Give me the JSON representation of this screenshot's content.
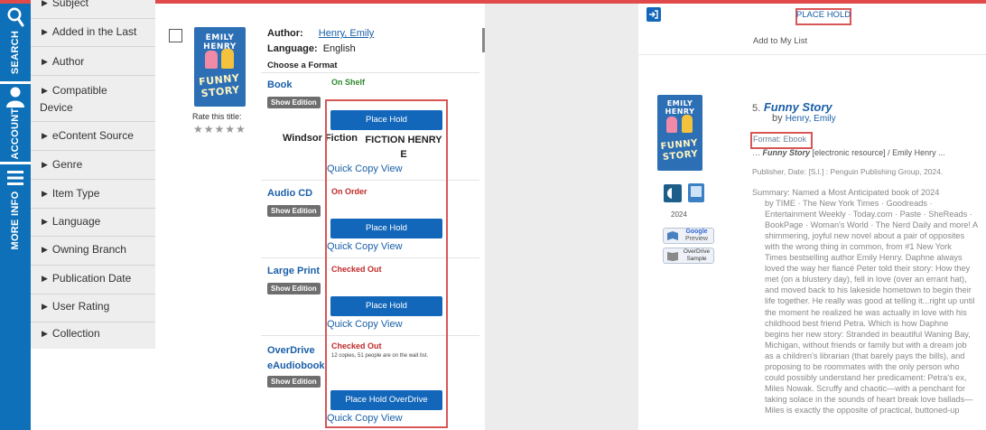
{
  "sidebar_tabs": [
    {
      "label": "SEARCH",
      "icon": "search-icon"
    },
    {
      "label": "ACCOUNT",
      "icon": "user-icon"
    },
    {
      "label": "MORE INFO",
      "icon": "menu-icon"
    }
  ],
  "facets": [
    "Subject",
    "Added in the Last",
    "Author",
    "Compatible Device",
    "eContent Source",
    "Genre",
    "Item Type",
    "Language",
    "Owning Branch",
    "Publication Date",
    "User Rating",
    "Collection"
  ],
  "result": {
    "cover": {
      "author_text": "EMILY HENRY",
      "title_text": "FUNNY STORY"
    },
    "rate_label": "Rate this title:",
    "stars": "★★★★★",
    "author_label": "Author:",
    "author_value": "Henry, Emily",
    "language_label": "Language:",
    "language_value": "English",
    "choose_format": "Choose a Format",
    "show_edition": "Show Edition",
    "formats": [
      {
        "name": "Book",
        "status": "On Shelf",
        "button": "Place Hold",
        "location": "Windsor Fiction",
        "call_number": "FICTION HENRY E",
        "quick_copy": "Quick Copy View"
      },
      {
        "name": "Audio CD",
        "status": "On Order",
        "button": "Place Hold",
        "quick_copy": "Quick Copy View"
      },
      {
        "name": "Large Print",
        "status": "Checked Out",
        "button": "Place Hold",
        "quick_copy": "Quick Copy View"
      },
      {
        "name": "OverDrive eAudiobook",
        "status": "Checked Out",
        "note": "12 copies, 51 people are on the wait list.",
        "button": "Place Hold OverDrive",
        "quick_copy": "Quick Copy View"
      }
    ]
  },
  "detail": {
    "place_hold": "PLACE HOLD",
    "add_to_list": "Add to My List",
    "number": "5.",
    "title": "Funny Story",
    "by_label": "by",
    "author": "Henry, Emily",
    "format_line": "Format: Ebook",
    "statement_title": "Funny Story",
    "statement_rest": "[electronic resource] / Emily Henry ...",
    "publisher": "Publisher, Date: [S.l.] : Penguin Publishing Group, 2024.",
    "year": "2024",
    "google_preview_line1": "Google",
    "google_preview_line2": "Preview",
    "overdrive_line1": "OverDrive",
    "overdrive_line2": "Sample",
    "summary_lines": [
      "Summary: Named a Most Anticipated book of 2024",
      "by TIME · The New York Times · Goodreads ·",
      "Entertainment Weekly · Today.com · Paste · SheReads ·",
      "BookPage · Woman's World · The Nerd Daily and more! A",
      "shimmering, joyful new novel about a pair of opposites",
      "with the wrong thing in common, from #1 New York",
      "Times bestselling author Emily Henry. Daphne always",
      "loved the way her fiancé Peter told their story: How they",
      "met (on a blustery day), fell in love (over an errant hat),",
      "and moved back to his lakeside hometown to begin their",
      "life together. He really was good at telling it...right up until",
      "the moment he realized he was actually in love with his",
      "childhood best friend Petra.   Which is how Daphne",
      "begins her new story: Stranded in beautiful Waning Bay,",
      "Michigan, without friends or family but with a dream job",
      "as a children's librarian (that barely pays the bills), and",
      "proposing to be roommates with the only person who",
      "could possibly understand her predicament: Petra's ex,",
      "Miles Nowak.   Scruffy and chaotic—with a penchant for",
      "taking solace in the sounds of heart break love ballads—",
      "Miles is exactly the opposite of practical, buttoned-up"
    ]
  },
  "colors": {
    "accent": "#0d70b8",
    "button": "#1367ba",
    "status_green": "#2f8a2f",
    "status_red": "#c02a2a",
    "highlight_red": "#d95656"
  }
}
